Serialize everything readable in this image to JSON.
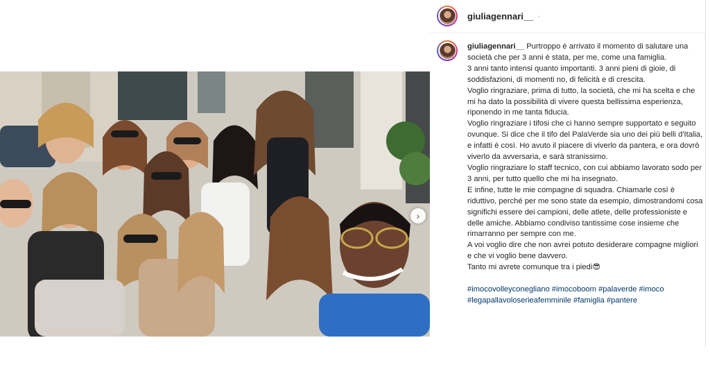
{
  "post": {
    "username": "giuliagennari__",
    "header_separator": "·",
    "image_alt": "Group selfie of the team smiling outdoors",
    "carousel_next_icon": "chevron-right-icon",
    "caption_lines": [
      "Purtroppo è arrivato il momento di salutare una società che per 3 anni è stata, per me, come una famiglia.",
      "3 anni tanto intensi quanto importanti. 3 anni pieni di gioie, di soddisfazioni, di momenti no, di felicità e di crescita.",
      "Voglio ringraziare, prima di tutto, la società, che mi ha scelta e che mi ha dato la possibilità di vivere questa bellissima esperienza, riponendo in me tanta fiducia.",
      "Voglio ringraziare i tifosi che ci hanno sempre supportato e seguito ovunque. Si dice che il tifo del PalaVerde sia uno dei più belli d'Italia, e infatti è così. Ho avuto il piacere di viverlo da pantera, e ora dovrò viverlo da avversaria, e sarà stranissimo.",
      "Voglio ringraziare lo staff tecnico, con cui abbiamo lavorato sodo per 3 anni, per tutto quello che mi ha insegnato.",
      "E infine, tutte le mie compagne di squadra. Chiamarle così è riduttivo, perché per me sono state da esempio, dimostrandomi cosa significhi essere dei campioni, delle atlete, delle professioniste e delle amiche. Abbiamo condiviso tantissime cose insieme che rimarranno per sempre con me.",
      "A voi voglio dire che non avrei potuto desiderare compagne migliori e che vi voglio bene davvero.",
      "Tanto mi avrete comunque tra i piedi😎"
    ],
    "hashtags": [
      "#imocovolleyconegliano",
      "#imocoboom",
      "#palaverde",
      "#imoco",
      "#legapallavoloserieafemminile",
      "#famiglia",
      "#pantere"
    ]
  },
  "colors": {
    "username": "#262626",
    "hashtag": "#00376b",
    "divider": "#dbdbdb"
  }
}
